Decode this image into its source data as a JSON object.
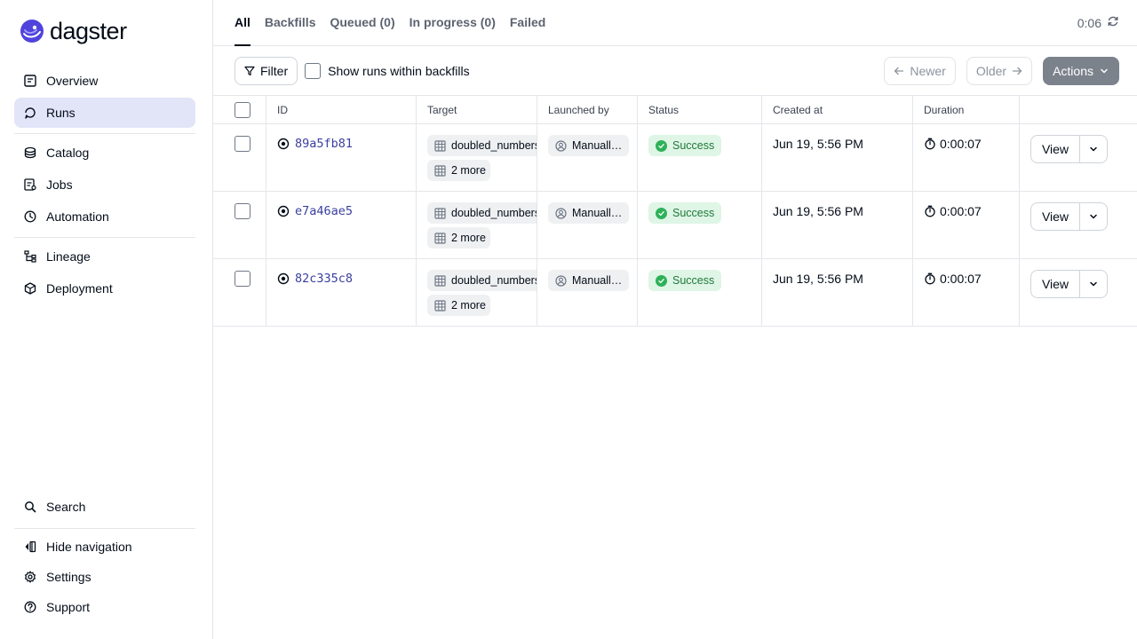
{
  "brand": {
    "name": "dagster",
    "accent": "#4f43dd"
  },
  "sidebar": {
    "groups": [
      [
        {
          "label": "Overview",
          "icon": "overview-icon"
        },
        {
          "label": "Runs",
          "icon": "runs-icon",
          "active": true
        }
      ],
      [
        {
          "label": "Catalog",
          "icon": "catalog-icon"
        },
        {
          "label": "Jobs",
          "icon": "jobs-icon"
        },
        {
          "label": "Automation",
          "icon": "automation-icon"
        }
      ],
      [
        {
          "label": "Lineage",
          "icon": "lineage-icon"
        },
        {
          "label": "Deployment",
          "icon": "deployment-icon"
        }
      ]
    ],
    "bottom": {
      "search": "Search",
      "hide_nav": "Hide navigation",
      "settings": "Settings",
      "support": "Support"
    }
  },
  "tabs": [
    {
      "label": "All",
      "active": true
    },
    {
      "label": "Backfills"
    },
    {
      "label": "Queued (0)"
    },
    {
      "label": "In progress (0)"
    },
    {
      "label": "Failed"
    }
  ],
  "refresh": {
    "timer": "0:06"
  },
  "toolbar": {
    "filter": "Filter",
    "show_runs": "Show runs within backfills",
    "newer": "Newer",
    "older": "Older",
    "actions": "Actions"
  },
  "table": {
    "headers": {
      "id": "ID",
      "target": "Target",
      "launched_by": "Launched by",
      "status": "Status",
      "created_at": "Created at",
      "duration": "Duration"
    },
    "rows": [
      {
        "id": "89a5fb81",
        "target": "doubled_numbers",
        "more": "2 more",
        "launched_by": "Manuall…",
        "status": "Success",
        "created_at": "Jun 19, 5:56 PM",
        "duration": "0:00:07",
        "view": "View"
      },
      {
        "id": "e7a46ae5",
        "target": "doubled_numbers",
        "more": "2 more",
        "launched_by": "Manuall…",
        "status": "Success",
        "created_at": "Jun 19, 5:56 PM",
        "duration": "0:00:07",
        "view": "View"
      },
      {
        "id": "82c335c8",
        "target": "doubled_numbers",
        "more": "2 more",
        "launched_by": "Manuall…",
        "status": "Success",
        "created_at": "Jun 19, 5:56 PM",
        "duration": "0:00:07",
        "view": "View"
      }
    ]
  }
}
